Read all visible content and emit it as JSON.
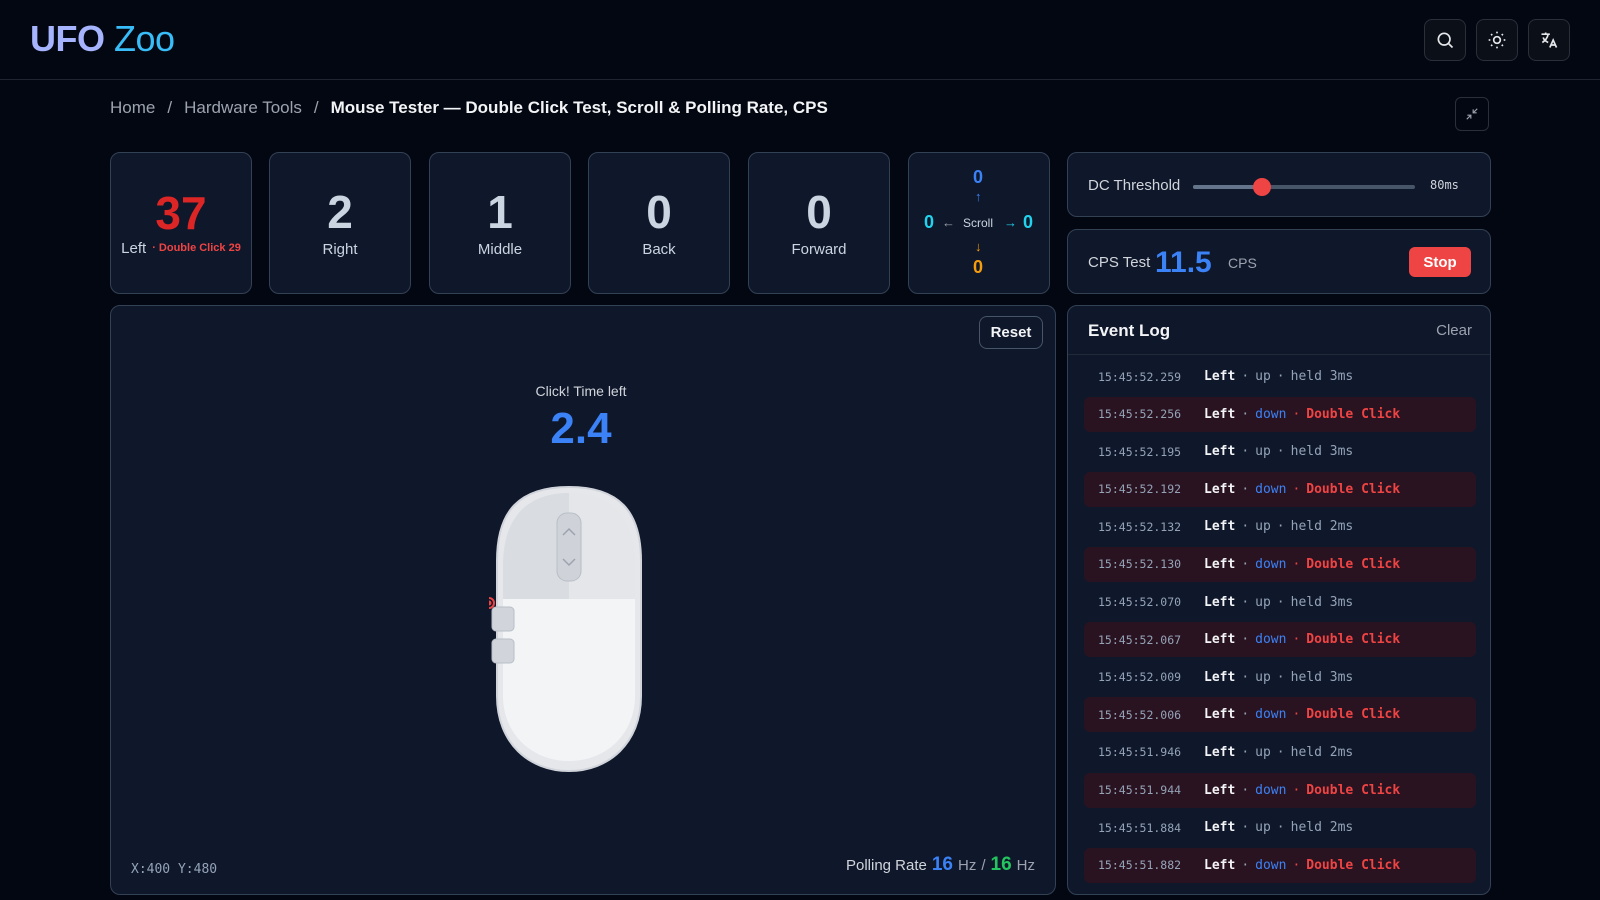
{
  "header": {
    "logo_part1": "UFO",
    "logo_part2": "Zoo",
    "icons": [
      "search-icon",
      "sun-icon",
      "translate-icon"
    ]
  },
  "breadcrumb": {
    "home": "Home",
    "separator": "/",
    "section": "Hardware Tools",
    "current": "Mouse Tester — Double Click Test, Scroll & Polling Rate, CPS"
  },
  "stats": {
    "left": {
      "count": "37",
      "label": "Left",
      "double_label": "· Double Click",
      "double_count": "29"
    },
    "right": {
      "count": "2",
      "label": "Right"
    },
    "middle": {
      "count": "1",
      "label": "Middle"
    },
    "back": {
      "count": "0",
      "label": "Back"
    },
    "forward": {
      "count": "0",
      "label": "Forward"
    }
  },
  "scroll": {
    "label": "Scroll",
    "up": "0",
    "down": "0",
    "left": "0",
    "right": "0",
    "up_arrow": "↑",
    "down_arrow": "↓",
    "left_arrow": "←",
    "right_arrow": "→"
  },
  "dc_threshold": {
    "label": "DC Threshold",
    "value_text": "80ms",
    "value_ms": 80,
    "fraction": 0.31
  },
  "cps_test": {
    "label": "CPS Test",
    "value": "11.5",
    "unit": "CPS",
    "stop_label": "Stop"
  },
  "test_area": {
    "reset_label": "Reset",
    "timer_label": "Click! Time left",
    "timer_value": "2.4",
    "coords": "X:400 Y:480",
    "polling_label": "Polling Rate",
    "polling_value_1": "16",
    "polling_value_2": "16",
    "polling_unit": "Hz",
    "polling_sep": "/"
  },
  "event_log": {
    "title": "Event Log",
    "clear_label": "Clear",
    "rows": [
      {
        "time": "15:45:52.259",
        "button": "Left",
        "action": "up",
        "note": "held 3ms",
        "double": false
      },
      {
        "time": "15:45:52.256",
        "button": "Left",
        "action": "down",
        "note": "Double Click",
        "double": true
      },
      {
        "time": "15:45:52.195",
        "button": "Left",
        "action": "up",
        "note": "held 3ms",
        "double": false
      },
      {
        "time": "15:45:52.192",
        "button": "Left",
        "action": "down",
        "note": "Double Click",
        "double": true
      },
      {
        "time": "15:45:52.132",
        "button": "Left",
        "action": "up",
        "note": "held 2ms",
        "double": false
      },
      {
        "time": "15:45:52.130",
        "button": "Left",
        "action": "down",
        "note": "Double Click",
        "double": true
      },
      {
        "time": "15:45:52.070",
        "button": "Left",
        "action": "up",
        "note": "held 3ms",
        "double": false
      },
      {
        "time": "15:45:52.067",
        "button": "Left",
        "action": "down",
        "note": "Double Click",
        "double": true
      },
      {
        "time": "15:45:52.009",
        "button": "Left",
        "action": "up",
        "note": "held 3ms",
        "double": false
      },
      {
        "time": "15:45:52.006",
        "button": "Left",
        "action": "down",
        "note": "Double Click",
        "double": true
      },
      {
        "time": "15:45:51.946",
        "button": "Left",
        "action": "up",
        "note": "held 2ms",
        "double": false
      },
      {
        "time": "15:45:51.944",
        "button": "Left",
        "action": "down",
        "note": "Double Click",
        "double": true
      },
      {
        "time": "15:45:51.884",
        "button": "Left",
        "action": "up",
        "note": "held 2ms",
        "double": false
      },
      {
        "time": "15:45:51.882",
        "button": "Left",
        "action": "down",
        "note": "Double Click",
        "double": true
      }
    ]
  },
  "colors": {
    "accent_blue": "#3b82f6",
    "accent_red": "#ef4444",
    "accent_green": "#22c55e",
    "accent_yellow": "#f59e0b",
    "accent_cyan": "#22d3ee"
  }
}
